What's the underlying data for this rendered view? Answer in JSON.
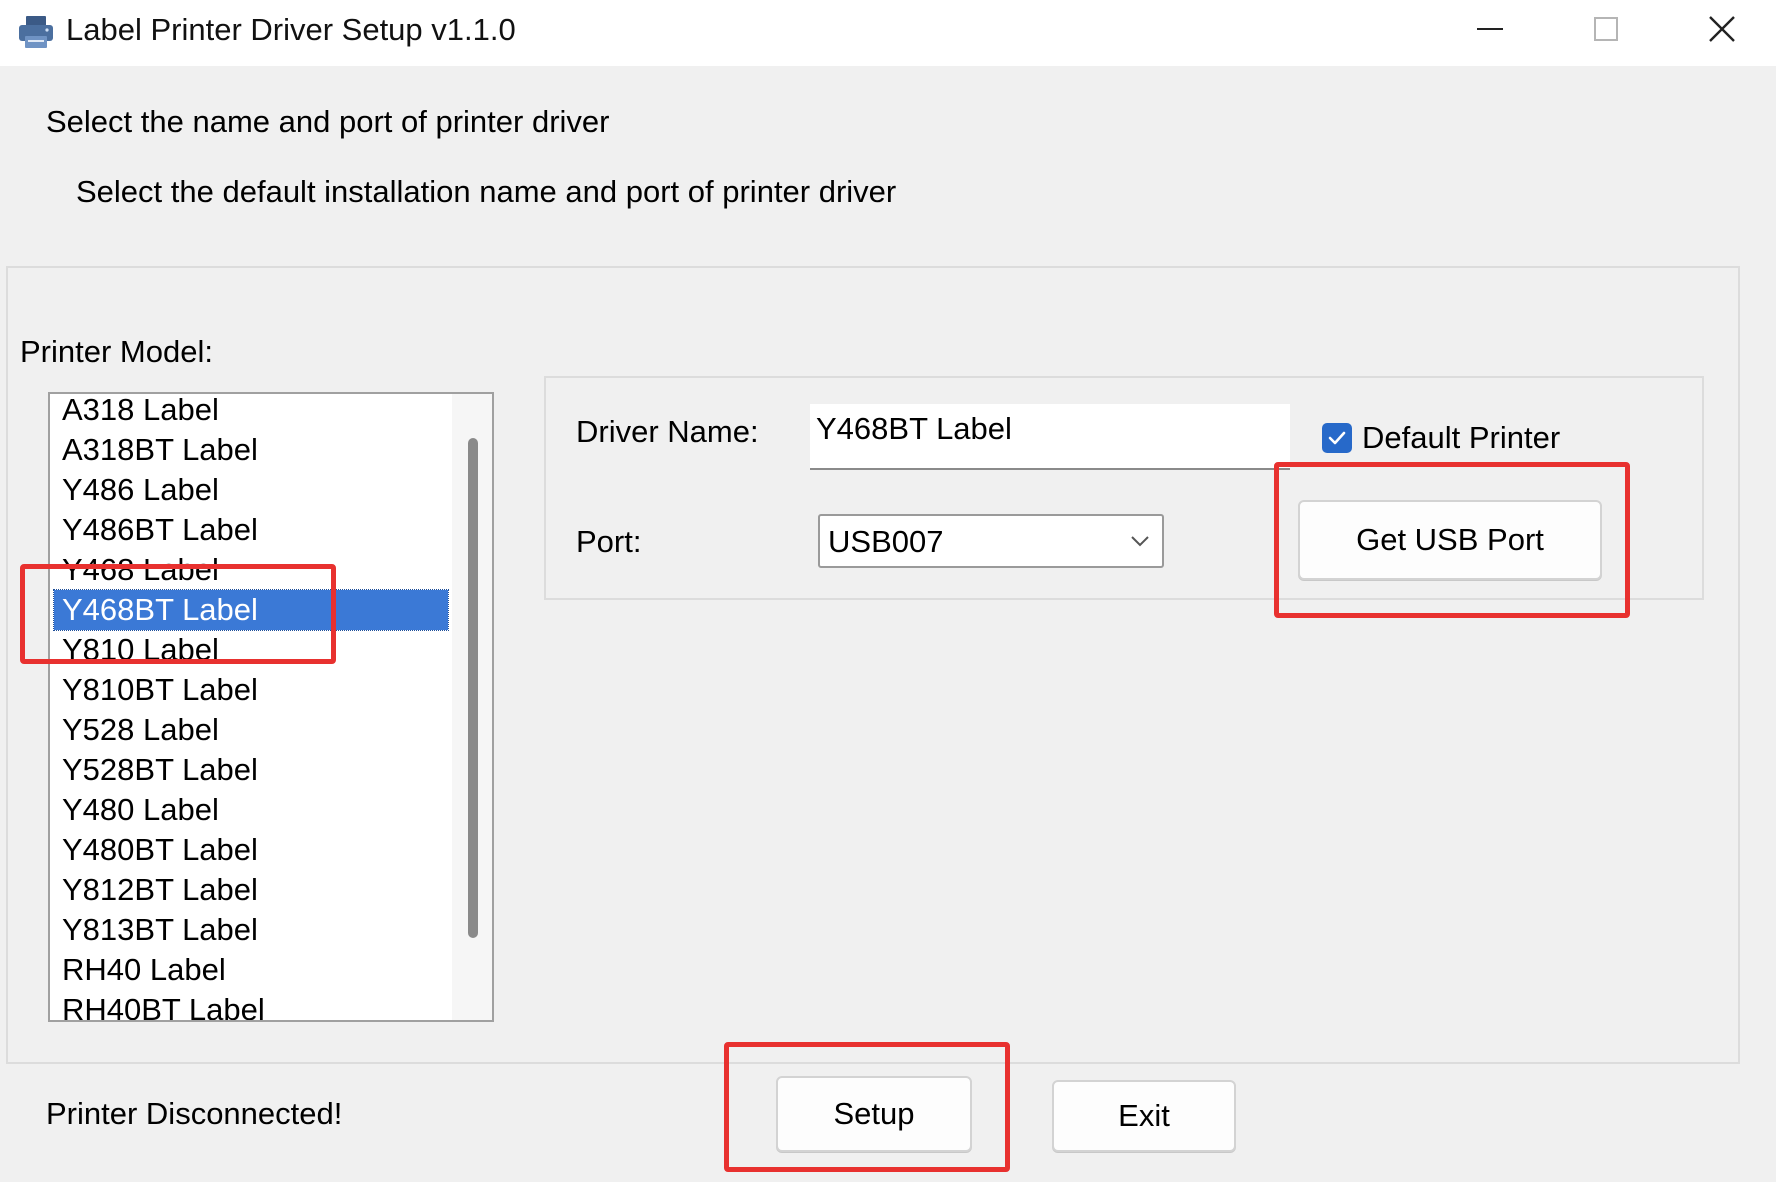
{
  "window": {
    "title": "Label Printer Driver Setup v1.1.0"
  },
  "header": {
    "heading": "Select the name and port of printer driver",
    "subheading": "Select the default installation name and port of printer driver"
  },
  "model_list": {
    "label": "Printer Model:",
    "items": [
      "A318 Label",
      "A318BT Label",
      "Y486 Label",
      "Y486BT Label",
      "Y468 Label",
      "Y468BT Label",
      "Y810 Label",
      "Y810BT Label",
      "Y528 Label",
      "Y528BT Label",
      "Y480 Label",
      "Y480BT Label",
      "Y812BT Label",
      "Y813BT Label",
      "RH40 Label",
      "RH40BT Label"
    ],
    "selected": "Y468BT Label"
  },
  "config": {
    "driver_name_label": "Driver Name:",
    "driver_name_value": "Y468BT Label",
    "port_label": "Port:",
    "port_value": "USB007",
    "default_printer_label": "Default Printer",
    "default_printer_checked": true,
    "get_usb_port_label": "Get USB Port"
  },
  "footer": {
    "status": "Printer Disconnected!",
    "setup_label": "Setup",
    "exit_label": "Exit"
  },
  "colors": {
    "selection": "#3b79d6",
    "highlight": "#e8312f",
    "checkbox": "#2769c9"
  },
  "icons": {
    "app": "printer-icon",
    "minimize": "minimize-icon",
    "maximize": "maximize-icon",
    "close": "close-icon",
    "dropdown": "chevron-down-icon",
    "check": "checkmark-icon"
  }
}
